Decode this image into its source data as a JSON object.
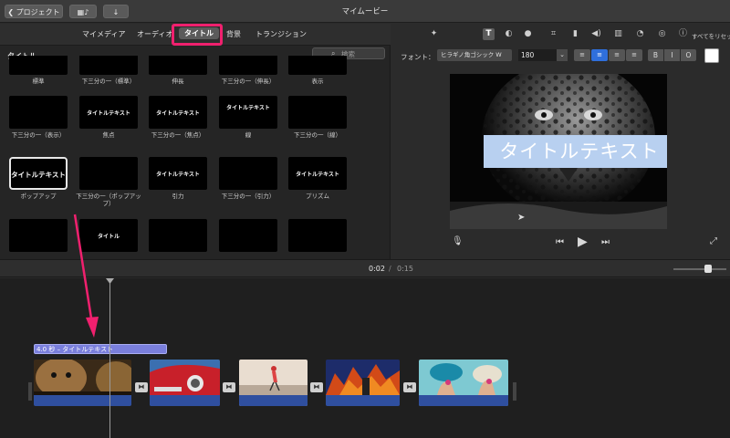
{
  "topbar": {
    "back_label": "プロジェクト",
    "title": "マイムービー"
  },
  "media_tabs": [
    {
      "label": "マイメディア",
      "active": false
    },
    {
      "label": "オーディオ",
      "active": false
    },
    {
      "label": "タイトル",
      "active": true
    },
    {
      "label": "背景",
      "active": false
    },
    {
      "label": "トランジション",
      "active": false
    }
  ],
  "browser": {
    "title": "タイトル",
    "search_placeholder": "検索"
  },
  "titles": [
    {
      "label": "標準",
      "thumb_text": ""
    },
    {
      "label": "下三分の一（標準）",
      "thumb_text": ""
    },
    {
      "label": "伸長",
      "thumb_text": ""
    },
    {
      "label": "下三分の一（伸長）",
      "thumb_text": ""
    },
    {
      "label": "表示",
      "thumb_text": ""
    },
    {
      "label": "下三分の一（表示）",
      "thumb_text": ""
    },
    {
      "label": "焦点",
      "thumb_text": "タイトルテキスト"
    },
    {
      "label": "下三分の一（焦点）",
      "thumb_text": "タイトルテキスト"
    },
    {
      "label": "線",
      "thumb_text": "タイトルテキスト"
    },
    {
      "label": "下三分の一（線）",
      "thumb_text": ""
    },
    {
      "label": "ポップアップ",
      "thumb_text": "タイトルテキスト"
    },
    {
      "label": "下三分の一（ポップアップ）",
      "thumb_text": ""
    },
    {
      "label": "引力",
      "thumb_text": "タイトルテキスト"
    },
    {
      "label": "下三分の一（引力）",
      "thumb_text": ""
    },
    {
      "label": "プリズム",
      "thumb_text": "タイトルテキスト"
    },
    {
      "label": "",
      "thumb_text": ""
    },
    {
      "label": "",
      "thumb_text": "タイトル"
    },
    {
      "label": "",
      "thumb_text": ""
    },
    {
      "label": "",
      "thumb_text": ""
    },
    {
      "label": "",
      "thumb_text": ""
    }
  ],
  "inspector": {
    "reset_label": "すべてをリセット",
    "font_label": "フォント：",
    "font_name": "ヒラギノ角ゴシック W",
    "font_size": "180",
    "bold": "B",
    "italic": "I",
    "outline": "O",
    "text_color": "#ffffff"
  },
  "viewer": {
    "title_text": "タイトルテキスト",
    "selection_color": "#b8d0f0"
  },
  "timeline": {
    "current_time": "0:02",
    "separator": "/",
    "total_time": "0:15",
    "title_clip_label": "4.0 秒 – タイトルテキスト"
  },
  "annotation": {
    "highlight_color": "#f0206e"
  }
}
